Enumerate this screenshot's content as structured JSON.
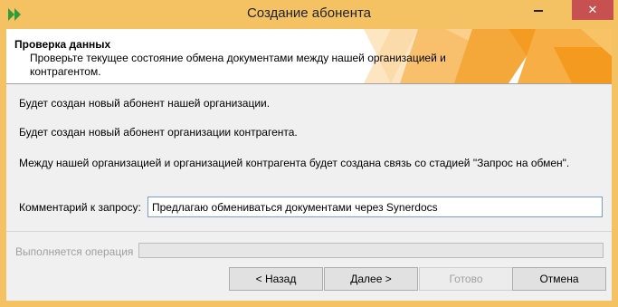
{
  "window": {
    "title": "Создание абонента",
    "close_glyph": "✕",
    "accent_color": "#f4c262"
  },
  "banner": {
    "title": "Проверка данных",
    "subtitle": "Проверьте текущее состояние обмена документами между нашей организацией и контрагентом."
  },
  "messages": {
    "line1": "Будет создан новый абонент нашей организации.",
    "line2": "Будет создан новый абонент организации контрагента.",
    "line3": "Между нашей организацией и организацией контрагента будет создана связь со стадией \"Запрос на обмен\"."
  },
  "comment": {
    "label": "Комментарий к запросу:",
    "value": "Предлагаю обмениваться документами через Synerdocs"
  },
  "progress": {
    "label": "Выполняется операция",
    "percent": 0
  },
  "buttons": {
    "back": "< Назад",
    "next": "Далее >",
    "done": "Готово",
    "cancel": "Отмена"
  }
}
